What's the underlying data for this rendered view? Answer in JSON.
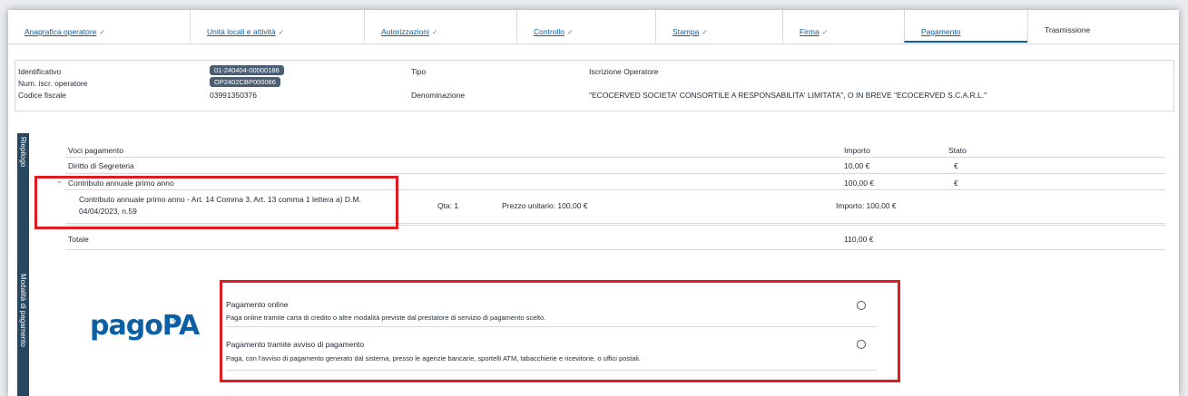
{
  "tabs": [
    {
      "label": "Anagrafica operatore",
      "check": "✓"
    },
    {
      "label": "Unità locali e attività",
      "check": "✓"
    },
    {
      "label": "Autorizzazioni",
      "check": "✓"
    },
    {
      "label": "Controllo",
      "check": "✓"
    },
    {
      "label": "Stampa",
      "check": "✓"
    },
    {
      "label": "Firma",
      "check": "✓"
    },
    {
      "label": "Pagamento",
      "check": ""
    },
    {
      "label": "Trasmissione",
      "check": ""
    }
  ],
  "identity": {
    "identificativo_label": "Identificativo",
    "identificativo_value": "01-240404-00000186",
    "num_label": "Num. iscr. operatore",
    "num_value": "OP2402CBP000066",
    "cf_label": "Codice fiscale",
    "cf_value": "03991350376",
    "tipo_label": "Tipo",
    "tipo_value": "Iscrizione Operatore",
    "den_label": "Denominazione",
    "den_value": "\"ECOCERVED SOCIETA' CONSORTILE A RESPONSABILITA' LIMITATA\", O IN BREVE \"ECOCERVED S.C.A.R.L.\""
  },
  "riepilogo": {
    "side_label": "Riepilogo",
    "headers": {
      "voci": "Voci pagamento",
      "importo": "Importo",
      "stato": "Stato"
    },
    "rows": [
      {
        "voce": "Diritto di Segreteria",
        "importo": "10,00 €",
        "stato": "€"
      },
      {
        "voce": "Contributo annuale primo anno",
        "importo": "100,00 €",
        "stato": "€"
      }
    ],
    "detail": {
      "desc": "Contributo annuale primo anno - Art. 14 Comma 3, Art. 13 comma 1 lettera a) D.M. 04/04/2023, n.59",
      "qta": "Qta: 1",
      "prezzo": "Prezzo unitario: 100,00 €",
      "importo": "Importo: 100,00 €"
    },
    "totale_label": "Totale",
    "totale_value": "110,00 €"
  },
  "pagamento": {
    "side_label": "Modalità di pagamento",
    "logo": "pagoPA",
    "logo_mark": "®",
    "options": [
      {
        "title": "Pagamento online",
        "desc": "Paga online tramite carta di credito o altre modalità previste dal prestatore di servizio di pagamento scelto."
      },
      {
        "title": "Pagamento tramite avviso di pagamento",
        "desc": "Paga, con l'avviso di pagamento generato dal sistema, presso le agenzie bancarie, sportelli ATM, tabacchierie e ricevitorie, o uffici postali."
      }
    ]
  },
  "colors": {
    "accent": "#0b5fa5",
    "sidebar": "#25475f",
    "highlight": "#e01b22"
  }
}
